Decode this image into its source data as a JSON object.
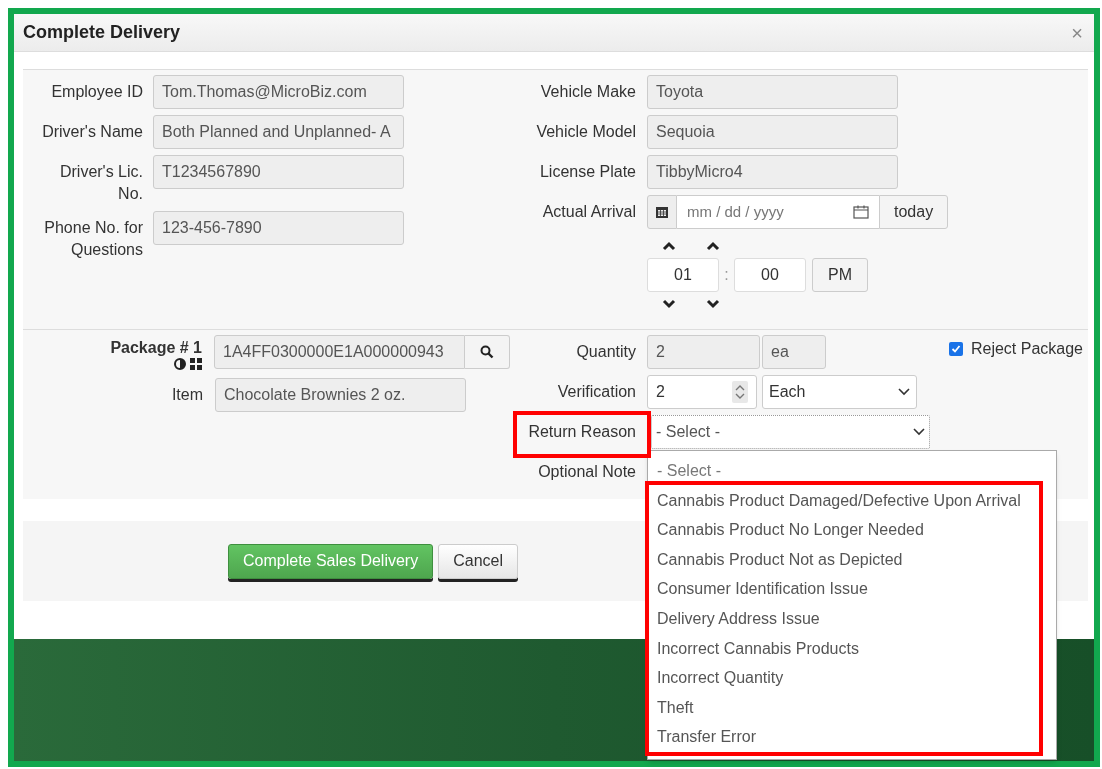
{
  "dialog": {
    "title": "Complete Delivery",
    "close": "×"
  },
  "driver_fields": [
    {
      "label": "Employee ID",
      "value": "Tom.Thomas@MicroBiz.com"
    },
    {
      "label": "Driver's Name",
      "value": "Both Planned and Unplanned- A"
    },
    {
      "label": "Driver's Lic. No.",
      "value": "T1234567890"
    },
    {
      "label": "Phone No. for Questions",
      "value": "123-456-7890"
    }
  ],
  "vehicle_fields": [
    {
      "label": "Vehicle Make",
      "value": "Toyota"
    },
    {
      "label": "Vehicle Model",
      "value": "Sequoia"
    },
    {
      "label": "License Plate",
      "value": "TibbyMicro4"
    }
  ],
  "actual_arrival": {
    "label": "Actual Arrival",
    "date_placeholder": "mm / dd / yyyy",
    "today_button": "today",
    "hour": "01",
    "separator": ":",
    "minute": "00",
    "meridiem": "PM"
  },
  "package": {
    "label": "Package # 1",
    "number": "1A4FF0300000E1A000000943",
    "item_label": "Item",
    "item": "Chocolate Brownies 2 oz.",
    "quantity_label": "Quantity",
    "quantity": "2",
    "unit": "ea",
    "reject": {
      "label": "Reject Package",
      "checked": true
    },
    "verification_label": "Verification",
    "verification": "2",
    "verification_unit": "Each",
    "return_reason": {
      "label": "Return Reason",
      "value": "- Select -",
      "highlighted": true
    },
    "optional_note_label": "Optional Note"
  },
  "dropdown": {
    "first_option": "- Select -",
    "options_highlighted": true,
    "options": [
      "Cannabis Product Damaged/Defective Upon Arrival",
      "Cannabis Product No Longer Needed",
      "Cannabis Product Not as Depicted",
      "Consumer Identification Issue",
      "Delivery Address Issue",
      "Incorrect Cannabis Products",
      "Incorrect Quantity",
      "Theft",
      "Transfer Error"
    ]
  },
  "buttons": [
    {
      "label": "Complete Sales Delivery",
      "kind": "primary"
    },
    {
      "label": "Cancel",
      "kind": "default"
    }
  ]
}
